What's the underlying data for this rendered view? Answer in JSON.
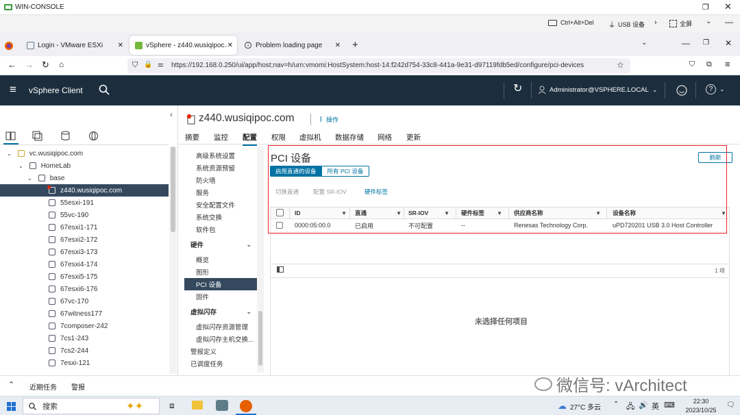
{
  "rdp": {
    "title": "WIN-CONSOLE",
    "cad": "Ctrl+Alt+Del",
    "usb": "USB 设备",
    "fullscreen": "全屏"
  },
  "browser": {
    "tabs": [
      {
        "label": "Login - VMware ESXi"
      },
      {
        "label": "vSphere - z440.wusiqipoc.co"
      },
      {
        "label": "Problem loading page"
      }
    ],
    "url": "https://192.168.0.250/ui/app/host;nav=h/urn:vmomi:HostSystem:host-14:f242d754-33c8-441a-9e31-d97119fdb5ed/configure/pci-devices"
  },
  "vsphere": {
    "app_title": "vSphere Client",
    "user": "Administrator@VSPHERE.LOCAL"
  },
  "tree": [
    {
      "label": "vc.wusiqipoc.com"
    },
    {
      "label": "HomeLab"
    },
    {
      "label": "base"
    },
    {
      "label": "z440.wusiqipoc.com"
    },
    {
      "label": "55esxi-191"
    },
    {
      "label": "55vc-190"
    },
    {
      "label": "67esxi1-171"
    },
    {
      "label": "67esxi2-172"
    },
    {
      "label": "67esxi3-173"
    },
    {
      "label": "67esxi4-174"
    },
    {
      "label": "67esxi5-175"
    },
    {
      "label": "67esxi6-176"
    },
    {
      "label": "67vc-170"
    },
    {
      "label": "67witness177"
    },
    {
      "label": "7composer-242"
    },
    {
      "label": "7cs1-243"
    },
    {
      "label": "7cs2-244"
    },
    {
      "label": "7esxi-121"
    }
  ],
  "host": {
    "name": "z440.wusiqipoc.com",
    "actions": "操作"
  },
  "main_tabs": [
    "摘要",
    "监控",
    "配置",
    "权限",
    "虚拟机",
    "数据存储",
    "网络",
    "更新"
  ],
  "config_nav": [
    {
      "label": "高级系统设置"
    },
    {
      "label": "系统资源预留"
    },
    {
      "label": "防火墙"
    },
    {
      "label": "服务"
    },
    {
      "label": "安全配置文件"
    },
    {
      "label": "系统交换"
    },
    {
      "label": "软件包"
    },
    {
      "label": "硬件"
    },
    {
      "label": "概览"
    },
    {
      "label": "图形"
    },
    {
      "label": "PCI 设备"
    },
    {
      "label": "固件"
    },
    {
      "label": "虚拟闪存"
    },
    {
      "label": "虚拟闪存资源管理"
    },
    {
      "label": "虚拟闪存主机交换..."
    },
    {
      "label": "警报定义"
    },
    {
      "label": "已调度任务"
    }
  ],
  "pci": {
    "title": "PCI 设备",
    "refresh": "刷新",
    "filter_tabs": [
      "启用直通的设备",
      "所有 PCI 设备"
    ],
    "actions": [
      "切换直通",
      "配置 SR-IOV",
      "硬件标签"
    ],
    "columns": [
      "ID",
      "直通",
      "SR-IOV",
      "硬件标签",
      "供应商名称",
      "设备名称"
    ],
    "rows": [
      {
        "id": "0000:05:00.0",
        "passthrough": "已启用",
        "sriov": "不可配置",
        "hwlabel": "--",
        "vendor": "Renesas Technology Corp.",
        "device": "uPD720201 USB 3.0 Host Controller"
      }
    ],
    "count": "1 项",
    "empty_detail": "未选择任何项目"
  },
  "bottom": {
    "recent_tasks": "近期任务",
    "alarms": "警报",
    "watermark": "微信号: vArchitect"
  },
  "taskbar": {
    "search": "搜索",
    "weather": "27°C 多云",
    "lang": "英",
    "time": "22:30",
    "date": "2023/10/25"
  }
}
